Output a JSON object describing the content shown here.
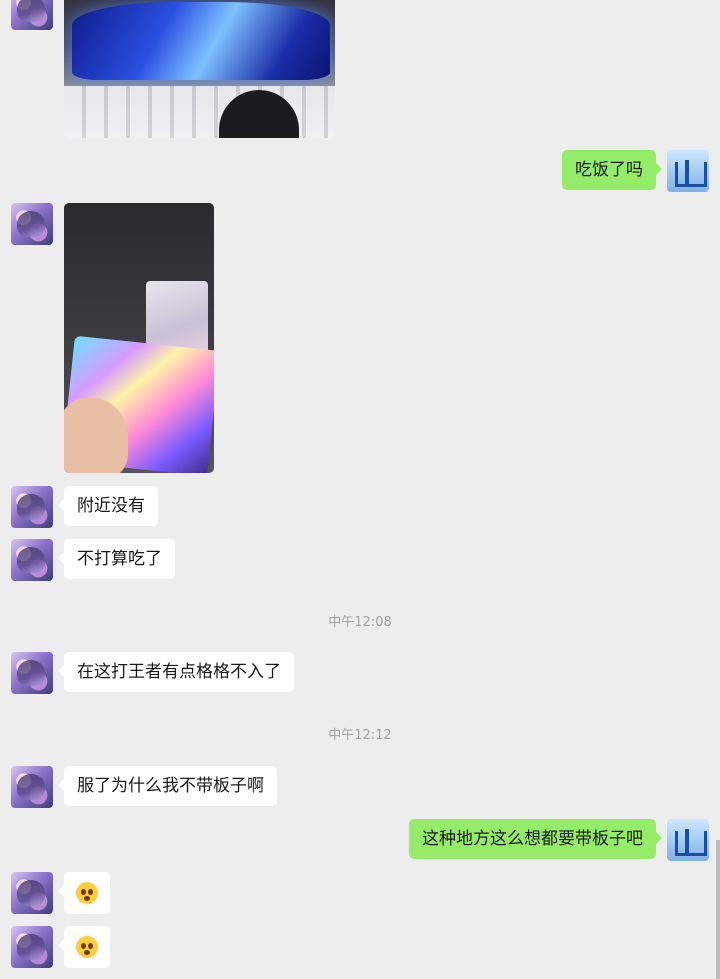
{
  "messages": [
    {
      "id": "m1",
      "side": "in",
      "type": "image",
      "image_name": "event-venue-photo"
    },
    {
      "id": "m2",
      "side": "out",
      "type": "text",
      "text": "吃饭了吗"
    },
    {
      "id": "m3",
      "side": "in",
      "type": "image",
      "image_name": "holographic-card-photo"
    },
    {
      "id": "m4",
      "side": "in",
      "type": "text",
      "text": "附近没有"
    },
    {
      "id": "m5",
      "side": "in",
      "type": "text",
      "text": "不打算吃了"
    },
    {
      "id": "t1",
      "type": "timestamp",
      "text": "中午12:08"
    },
    {
      "id": "m6",
      "side": "in",
      "type": "text",
      "text": "在这打王者有点格格不入了"
    },
    {
      "id": "t2",
      "type": "timestamp",
      "text": "中午12:12"
    },
    {
      "id": "m7",
      "side": "in",
      "type": "text",
      "text": "服了为什么我不带板子啊"
    },
    {
      "id": "m8",
      "side": "out",
      "type": "text",
      "text": "这种地方这么想都要带板子吧"
    },
    {
      "id": "m9",
      "side": "in",
      "type": "emoji",
      "icon": "flushed-face-icon"
    },
    {
      "id": "m10",
      "side": "in",
      "type": "emoji",
      "icon": "flushed-face-icon"
    }
  ],
  "colors": {
    "background": "#ededed",
    "incoming_bubble": "#ffffff",
    "outgoing_bubble": "#95ec69",
    "timestamp_text": "#a3a3a3"
  }
}
